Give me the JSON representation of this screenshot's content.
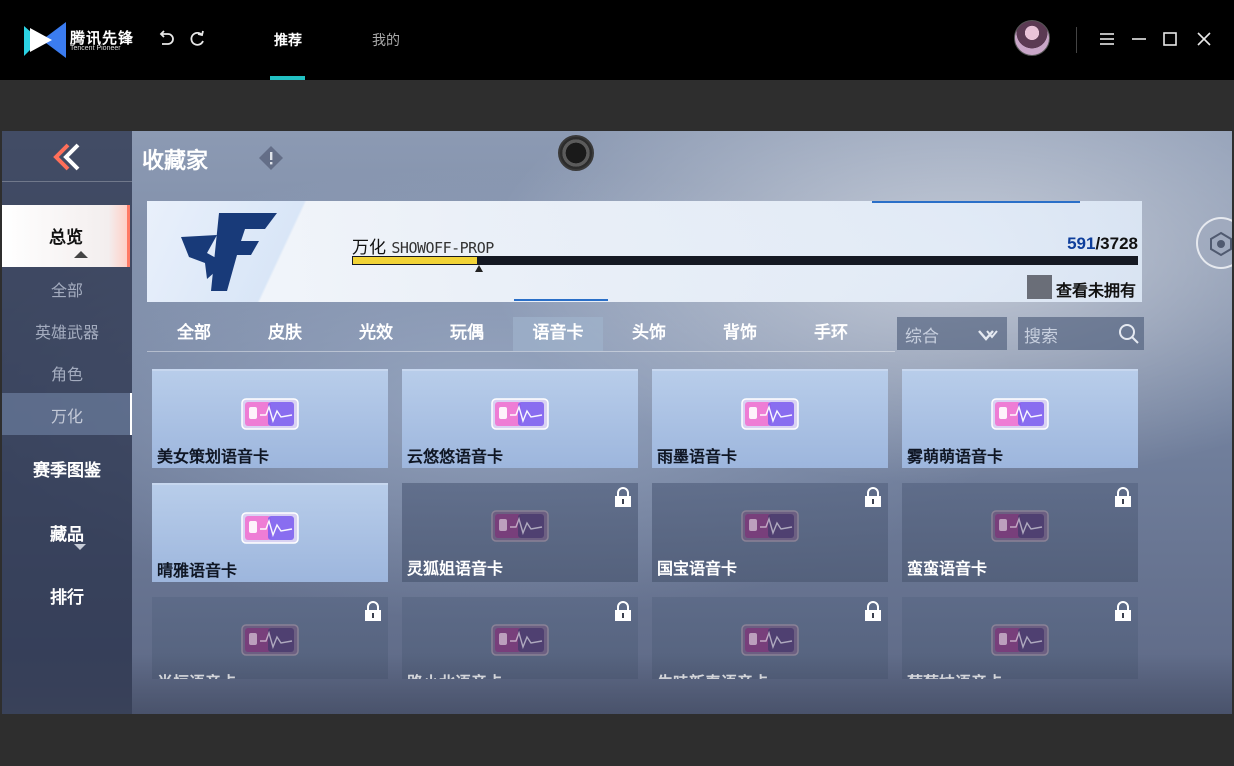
{
  "app": {
    "brand": "腾讯先锋",
    "brand_sub": "Tencent Pioneer",
    "tabs": [
      {
        "label": "推荐",
        "active": true
      },
      {
        "label": "我的",
        "active": false
      }
    ],
    "accent_color": "#22c1c3"
  },
  "game": {
    "title": "收藏家",
    "left_nav": {
      "overview": "总览",
      "sub_items": [
        "全部",
        "英雄武器",
        "角色",
        "万化"
      ],
      "active_sub": "万化",
      "season": "赛季图鉴",
      "collection": "藏品",
      "ranking": "排行"
    },
    "banner": {
      "label_cn": "万化",
      "label_en": "SHOWOFF-PROP",
      "owned": "591",
      "total": "/3728",
      "progress": 0.1585,
      "checkbox_label": "查看未拥有",
      "checkbox_checked": false
    },
    "filter_tabs": [
      "全部",
      "皮肤",
      "光效",
      "玩偶",
      "语音卡",
      "头饰",
      "背饰",
      "手环"
    ],
    "active_filter": "语音卡",
    "sort": {
      "value": "综合",
      "icon": "chevron-down-icon"
    },
    "search": {
      "placeholder": "搜索",
      "icon": "search-icon"
    },
    "cards": [
      {
        "name": "美女策划语音卡",
        "owned": true
      },
      {
        "name": "云悠悠语音卡",
        "owned": true
      },
      {
        "name": "雨墨语音卡",
        "owned": true
      },
      {
        "name": "雾萌萌语音卡",
        "owned": true
      },
      {
        "name": "晴雅语音卡",
        "owned": true
      },
      {
        "name": "灵狐姐语音卡",
        "owned": false
      },
      {
        "name": "国宝语音卡",
        "owned": false
      },
      {
        "name": "蛮蛮语音卡",
        "owned": false
      },
      {
        "name": "肖恒语音卡",
        "owned": false
      },
      {
        "name": "路小北语音卡",
        "owned": false
      },
      {
        "name": "牛哇新春语音卡",
        "owned": false
      },
      {
        "name": "莓莓妹语音卡",
        "owned": false
      }
    ]
  }
}
